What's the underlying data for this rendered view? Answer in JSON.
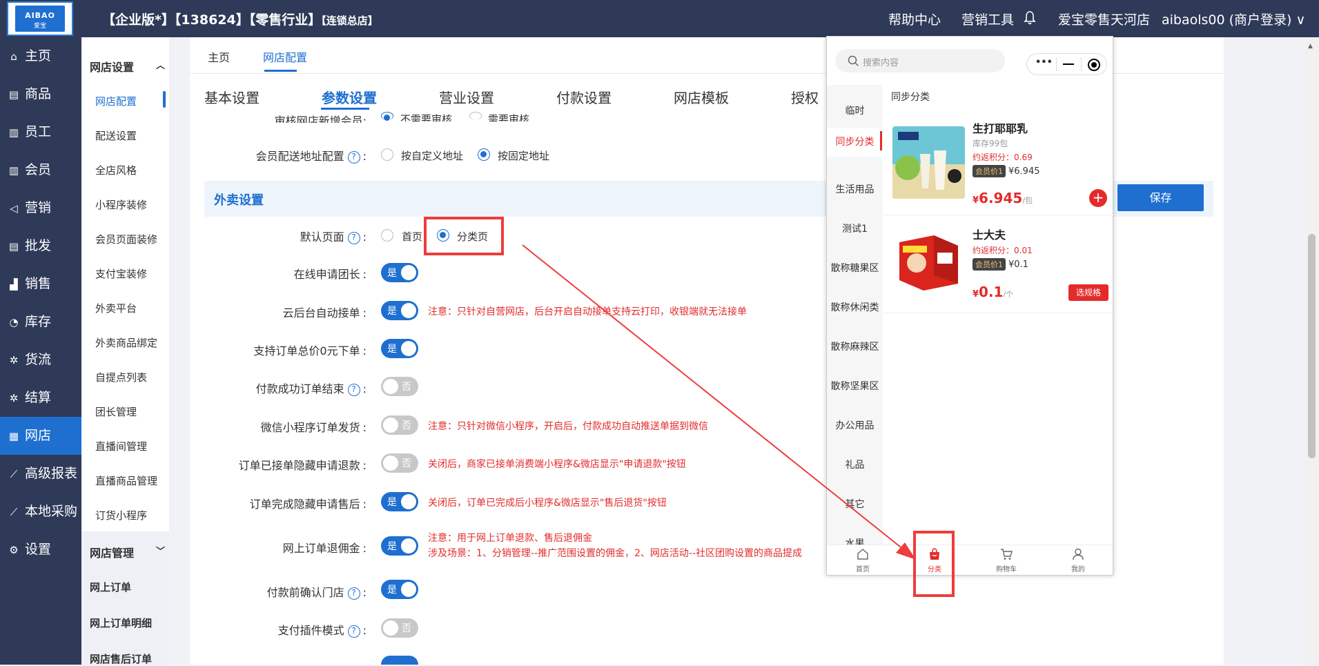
{
  "header": {
    "logo_text": "AIBAO",
    "logo_sub": "爱宝",
    "org_main": "【企业版*】【138624】【零售行业】",
    "org_tag": "【连锁总店】",
    "nav": [
      "帮助中心",
      "营销工具"
    ],
    "store": "爱宝零售天河店",
    "user": "aibaols00 (商户登录)  ∨"
  },
  "sidebar": {
    "items": [
      {
        "icon": "⌂",
        "label": "主页"
      },
      {
        "icon": "▤",
        "label": "商品"
      },
      {
        "icon": "▥",
        "label": "员工"
      },
      {
        "icon": "▥",
        "label": "会员"
      },
      {
        "icon": "◁",
        "label": "营销"
      },
      {
        "icon": "▤",
        "label": "批发"
      },
      {
        "icon": "▟",
        "label": "销售"
      },
      {
        "icon": "◔",
        "label": "库存"
      },
      {
        "icon": "✲",
        "label": "货流"
      },
      {
        "icon": "✲",
        "label": "结算"
      },
      {
        "icon": "▦",
        "label": "网店"
      },
      {
        "icon": "⟋",
        "label": "高级报表"
      },
      {
        "icon": "⟋",
        "label": "本地采购"
      },
      {
        "icon": "⚙",
        "label": "设置"
      }
    ]
  },
  "subsidebar": {
    "section1": "网店设置",
    "items": [
      "网店配置",
      "配送设置",
      "全店风格",
      "小程序装修",
      "会员页面装修",
      "支付宝装修",
      "外卖平台",
      "外卖商品绑定",
      "自提点列表",
      "团长管理",
      "直播间管理",
      "直播商品管理",
      "订货小程序"
    ],
    "section2": "网店管理",
    "items2": [
      "网上订单",
      "网上订单明细",
      "网店售后订单"
    ]
  },
  "page_tabs": [
    "主页",
    "网店配置"
  ],
  "setting_tabs": [
    "基本设置",
    "参数设置",
    "营业设置",
    "付款设置",
    "网店模板",
    "授权"
  ],
  "settings": {
    "partial_label": "审核网店新增会员:",
    "partial_opt1": "不需要审核",
    "partial_opt2": "需要审核",
    "member_addr_label": "会员配送地址配置",
    "member_addr_opt1": "按自定义地址",
    "member_addr_opt2": "按固定地址",
    "section_title": "外卖设置",
    "default_page_label": "默认页面",
    "default_page_opt1": "首页",
    "default_page_opt2": "分类页",
    "rows": [
      {
        "label": "在线申请团长",
        "state": "是",
        "note": ""
      },
      {
        "label": "云后台自动接单",
        "state": "是",
        "note": "注意：只针对自营网店，后台开启自动接单支持云打印，收银端就无法接单"
      },
      {
        "label": "支持订单总价0元下单",
        "state": "是",
        "note": ""
      },
      {
        "label": "付款成功订单结束",
        "state": "否",
        "note": ""
      },
      {
        "label": "微信小程序订单发货",
        "state": "否",
        "note": "注意：只针对微信小程序，开启后，付款成功自动推送单据到微信"
      },
      {
        "label": "订单已接单隐藏申请退款",
        "state": "否",
        "note": "关闭后，商家已接单消费端小程序&微店显示\"申请退款\"按钮"
      },
      {
        "label": "订单完成隐藏申请售后",
        "state": "是",
        "note": "关闭后，订单已完成后小程序&微店显示\"售后退货\"按钮"
      },
      {
        "label": "网上订单退佣金",
        "state": "是",
        "note": "注意：用于网上订单退款、售后退佣金",
        "note2": "涉及场景：1、分销管理--推广范围设置的佣金，2、网店活动--社区团购设置的商品提成"
      },
      {
        "label": "付款前确认门店",
        "state": "是",
        "note": ""
      },
      {
        "label": "支付插件模式",
        "state": "否",
        "note": ""
      }
    ],
    "save": "保存"
  },
  "phone": {
    "search_placeholder": "搜索内容",
    "capsule_dots": "•••",
    "categories": [
      "临时",
      "同步分类",
      "生活用品",
      "测试1",
      "散称糖果区",
      "散称休闲类",
      "散称麻辣区",
      "散称坚果区",
      "办公用品",
      "礼品",
      "其它",
      "水果"
    ],
    "group_title": "同步分类",
    "products": [
      {
        "name": "生打耶耶乳",
        "stock": "库存99包",
        "points": "约返积分：0.69",
        "member_badge": "会员价1",
        "member_price": "¥6.945",
        "currency": "¥",
        "price": "6.945",
        "unit": "/包"
      },
      {
        "name": "士大夫",
        "stock": "",
        "points": "约返积分：0.01",
        "member_badge": "会员价1",
        "member_price": "¥0.1",
        "currency": "¥",
        "price": "0.1",
        "unit": "/个",
        "spec_btn": "选规格"
      }
    ],
    "add_symbol": "+",
    "bottom_nav": [
      "首页",
      "分类",
      "购物车",
      "我的"
    ]
  },
  "colors": {
    "primary": "#1e6fd0",
    "header_bg": "#2f3a59",
    "danger": "#e32b2b",
    "annotation": "#ef3c3c"
  }
}
